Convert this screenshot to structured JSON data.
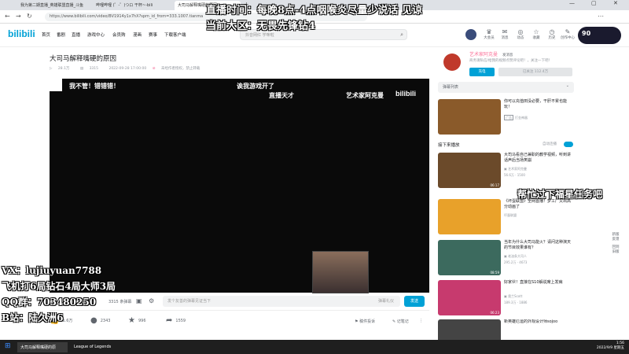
{
  "browser": {
    "tabs": [
      "我为第二期直播_英雄联盟直播_斗鱼",
      "哔哩哔哩 (゜-゜)つロ 干杯~-bili",
      "大司马解释嘴硬的原因"
    ],
    "url": "https://www.bilibili.com/video/BV1914y1x7hX?spm_id_from=333.1007.tianma"
  },
  "header": {
    "logo": "bilibili",
    "nav": [
      "首页",
      "番剧",
      "直播",
      "游戏中心",
      "会员购",
      "漫画",
      "赛事",
      "下载客户端"
    ],
    "search_placeholder": "抖音网红 学咪啦",
    "right_icons": [
      {
        "label": "大会员",
        "icon": "crown-icon"
      },
      {
        "label": "消息",
        "icon": "message-icon"
      },
      {
        "label": "动态",
        "icon": "feed-icon"
      },
      {
        "label": "收藏",
        "icon": "star-icon"
      },
      {
        "label": "历史",
        "icon": "history-icon"
      },
      {
        "label": "创作中心",
        "icon": "create-icon"
      }
    ],
    "live_widget_value": "90"
  },
  "overlays": {
    "top1": "直播时间：每晚8点-4点咽喉炎尽量少说话 见谅",
    "top2": "当前大区：无畏先锋钻4",
    "mid_right": "帮忙过下福星任务吧",
    "bottom_left": [
      "VX：lujiuyuan7788",
      "飞机打6局钻石4局大师3局",
      "QQ群：703480250",
      "B站：陆久洲6"
    ]
  },
  "video": {
    "title": "大司马解释嘴硬的原因",
    "views": "28.1万",
    "danmaku_count": "3315",
    "date": "2022-09-28 17:00:00",
    "notice": "未经作者授权，禁止转载",
    "overlay_texts": [
      "我不管！错错错！",
      "诶我游戏开了",
      "直播天才",
      "艺术家阿克曼"
    ],
    "danmaku_placeholder": "发个友善的弹幕见证当下",
    "danmaku_etiquette": "弹幕礼仪",
    "send_label": "发送",
    "danmu_label": "条弹幕"
  },
  "actions": {
    "like": "1.6万",
    "coin": "2343",
    "fav": "996",
    "share": "1559",
    "report": "稿件投诉",
    "notes": "记笔记"
  },
  "uploader": {
    "name": "艺术家阿克曼",
    "badge": "发消息",
    "desc": "商务请私信/给我的视频点赞评论吧！，关注一下吧！",
    "charge": "充电",
    "follow": "已关注 112.4万"
  },
  "sidebar": {
    "danmu_list": "弹幕列表",
    "ad": {
      "title": "你可以充值田没必要，干肝不累也能玩！",
      "tag": "广告",
      "sub": "打金神器"
    },
    "next_label": "接下来播放",
    "autoplay": "自动连播",
    "videos": [
      {
        "title": "大司马看自己兼职的教学视频，听到讲话声后当场笑崩",
        "author": "艺术家阿克曼",
        "views": "56.6万",
        "danmu": "1500",
        "dur": "06:17",
        "color": "#6b4a2a"
      },
      {
        "title": "《坏蛋联盟》全网首播！梦工厂又出高分动画了",
        "author": "坏蛋联盟",
        "views": "",
        "danmu": "",
        "dur": "",
        "color": "#e8a12a"
      },
      {
        "title": "当年为什么大司马能火？请问这种演天的节目效果谁有？",
        "author": "老油条大司人",
        "views": "295.2万",
        "danmu": "4673",
        "dur": "08:59",
        "color": "#3c6a5e"
      },
      {
        "title": "好家伙！直接在S10解说席上发病",
        "author": "奥兰Scott",
        "views": "189.3万",
        "danmu": "1886",
        "dur": "06:23",
        "color": "#c73a6e"
      },
      {
        "title": "新英雄厄运的外观设计师sojoo",
        "author": "",
        "views": "",
        "danmu": "",
        "dur": "",
        "color": "#444"
      }
    ],
    "float": [
      "新版",
      "反馈",
      "回到",
      "旧版"
    ]
  },
  "taskbar": {
    "items": [
      "大司马解释嘴硬的原",
      "League of Legends"
    ],
    "time": "1:56",
    "date": "2022/9/9 星期五"
  }
}
